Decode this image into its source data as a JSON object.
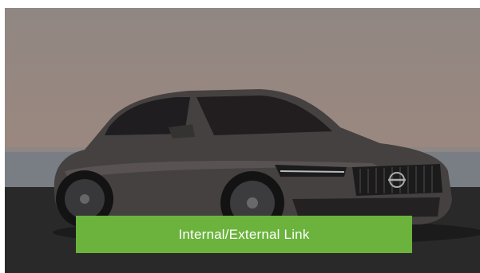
{
  "hero": {
    "image_subject": "car-photo",
    "cta_label": "Internal/External Link",
    "cta_color": "#6bb33c"
  }
}
